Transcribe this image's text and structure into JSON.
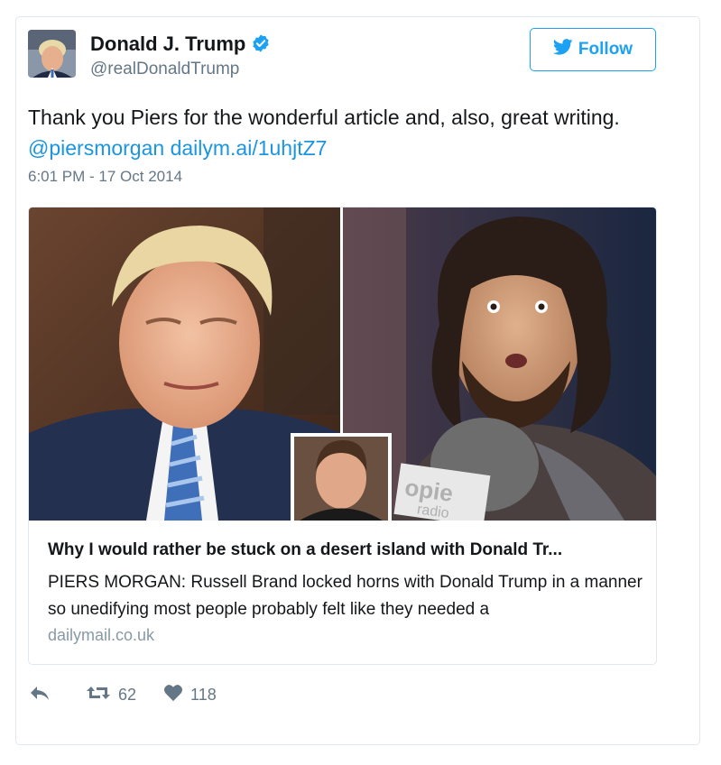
{
  "author": {
    "name": "Donald J. Trump",
    "handle": "@realDonaldTrump",
    "verified_icon": "verified-badge-icon"
  },
  "follow_button": {
    "label": "Follow",
    "icon": "twitter-bird-icon"
  },
  "tweet": {
    "text": "Thank you Piers for the wonderful article and, also, great writing.",
    "mention": "@piersmorgan",
    "link": "dailym.ai/1uhjtZ7",
    "timestamp": "6:01 PM - 17 Oct 2014"
  },
  "card": {
    "title": "Why I would rather be stuck on a desert island with Donald Tr...",
    "description": "PIERS MORGAN: Russell Brand locked horns with Donald Trump in a manner so unedifying most people probably felt like they needed a",
    "domain": "dailymail.co.uk",
    "mic_text": "opie",
    "mic_subtext": "radio"
  },
  "actions": {
    "reply_icon": "reply-icon",
    "retweet_icon": "retweet-icon",
    "retweet_count": "62",
    "like_icon": "heart-icon",
    "like_count": "118"
  },
  "colors": {
    "accent": "#1da1f2",
    "link": "#1b95e0",
    "muted": "#657786",
    "border": "#e1e8ed"
  }
}
